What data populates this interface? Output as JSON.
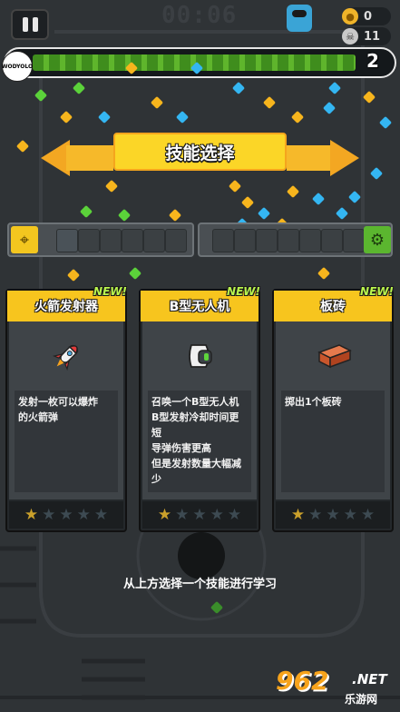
{
  "hud": {
    "timer": "00:06",
    "coins": "0",
    "kills": "11",
    "level": "2",
    "avatar_text": "WODYOLO",
    "xp_progress": 0.88
  },
  "title": "技能选择",
  "cards": [
    {
      "badge": "NEW!",
      "name": "火箭发射器",
      "icon": "rocket-icon",
      "description": "发射一枚可以爆炸\n的火箭弹",
      "stars": 1,
      "max_stars": 5
    },
    {
      "badge": "NEW!",
      "name": "B型无人机",
      "icon": "drone-icon",
      "description": "召唤一个B型无人机\nB型发射冷却时间更\n短\n导弹伤害更高\n但是发射数量大幅减\n少",
      "stars": 1,
      "max_stars": 5
    },
    {
      "badge": "NEW!",
      "name": "板砖",
      "icon": "brick-icon",
      "description": "掷出1个板砖",
      "stars": 1,
      "max_stars": 5
    }
  ],
  "hint": "从上方选择一个技能进行学习",
  "watermark": {
    "number": "962",
    "net": ".NET",
    "site": "乐游网"
  },
  "colors": {
    "accent_yellow": "#f7c51e",
    "xp_green": "#5fb52c",
    "star_gold": "#caa02b"
  }
}
